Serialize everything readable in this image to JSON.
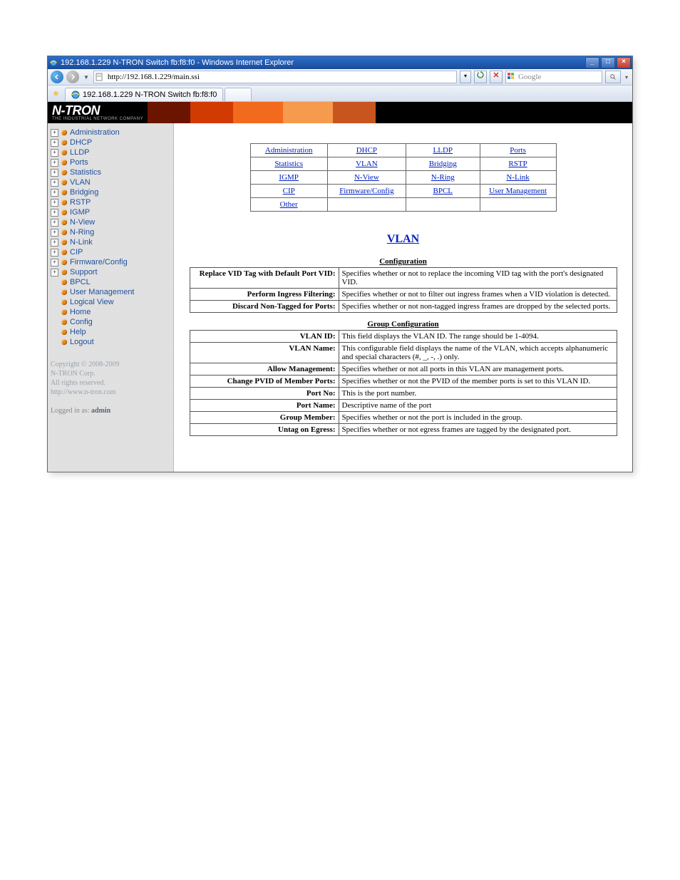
{
  "titlebar": {
    "text": "192.168.1.229 N-TRON Switch fb:f8:f0 - Windows Internet Explorer",
    "min": "_",
    "max": "□",
    "close": "×"
  },
  "address": {
    "url": "http://192.168.1.229/main.ssi",
    "search_placeholder": "Google"
  },
  "tab": {
    "label": "192.168.1.229 N-TRON Switch fb:f8:f0"
  },
  "logo": {
    "main": "N-TRON",
    "sub": "THE INDUSTRIAL NETWORK COMPANY"
  },
  "sidebar": {
    "items": [
      {
        "exp": "+",
        "label": "Administration"
      },
      {
        "exp": "+",
        "label": "DHCP"
      },
      {
        "exp": "+",
        "label": "LLDP"
      },
      {
        "exp": "+",
        "label": "Ports"
      },
      {
        "exp": "+",
        "label": "Statistics"
      },
      {
        "exp": "+",
        "label": "VLAN"
      },
      {
        "exp": "+",
        "label": "Bridging"
      },
      {
        "exp": "+",
        "label": "RSTP"
      },
      {
        "exp": "+",
        "label": "IGMP"
      },
      {
        "exp": "+",
        "label": "N-View"
      },
      {
        "exp": "+",
        "label": "N-Ring"
      },
      {
        "exp": "+",
        "label": "N-Link"
      },
      {
        "exp": "+",
        "label": "CIP"
      },
      {
        "exp": "+",
        "label": "Firmware/Config"
      },
      {
        "exp": "+",
        "label": "Support"
      },
      {
        "exp": "",
        "label": "BPCL"
      },
      {
        "exp": "",
        "label": "User Management"
      },
      {
        "exp": "",
        "label": "Logical View"
      },
      {
        "exp": "",
        "label": "Home"
      },
      {
        "exp": "",
        "label": "Config"
      },
      {
        "exp": "",
        "label": "Help"
      },
      {
        "exp": "",
        "label": "Logout"
      }
    ],
    "footer": {
      "copyright": "Copyright © 2008-2009",
      "company": "N-TRON Corp.",
      "rights": "All rights reserved.",
      "url": "http://www.n-tron.com"
    },
    "logged": {
      "prefix": "Logged in as:",
      "user": "admin"
    }
  },
  "help_grid": {
    "rows": [
      [
        "Administration",
        "DHCP",
        "LLDP",
        "Ports"
      ],
      [
        "Statistics",
        "VLAN",
        "Bridging",
        "RSTP"
      ],
      [
        "IGMP",
        "N-View",
        "N-Ring",
        "N-Link"
      ],
      [
        "CIP",
        "Firmware/Config",
        "BPCL",
        "User Management"
      ],
      [
        "Other",
        "",
        "",
        ""
      ]
    ]
  },
  "page_title": "VLAN",
  "config_header": "Configuration",
  "config_rows": [
    {
      "key": "Replace VID Tag with Default Port VID:",
      "val": "Specifies whether or not to replace the incoming VID tag with the port's designated VID."
    },
    {
      "key": "Perform Ingress Filtering:",
      "val": "Specifies whether or not to filter out ingress frames when a VID violation is detected."
    },
    {
      "key": "Discard Non-Tagged for Ports:",
      "val": "Specifies whether or not non-tagged ingress frames are dropped by the selected ports."
    }
  ],
  "group_header": "Group Configuration",
  "group_rows": [
    {
      "key": "VLAN ID:",
      "val": "This field displays the VLAN ID. The range should be 1-4094."
    },
    {
      "key": "VLAN Name:",
      "val": "This configurable field displays the name of the VLAN, which accepts alphanumeric and special characters (#, _, -, .) only."
    },
    {
      "key": "Allow Management:",
      "val": "Specifies whether or not all ports in this VLAN are management ports."
    },
    {
      "key": "Change PVID of Member Ports:",
      "val": "Specifies whether or not the PVID of the member ports is set to this VLAN ID."
    },
    {
      "key": "Port No:",
      "val": "This is the port number."
    },
    {
      "key": "Port Name:",
      "val": "Descriptive name of the port"
    },
    {
      "key": "Group Member:",
      "val": "Specifies whether or not the port is included in the group."
    },
    {
      "key": "Untag on Egress:",
      "val": "Specifies whether or not egress frames are tagged by the designated port."
    }
  ]
}
